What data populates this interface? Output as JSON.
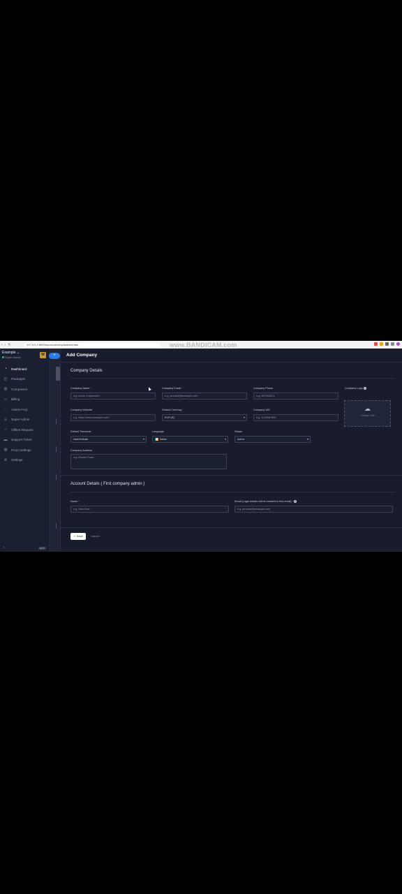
{
  "browser": {
    "url": "127.0.0.1:8000/account/companies/create",
    "watermark": "www.BANDICAM.com"
  },
  "sidebar": {
    "workspace_name": "Example",
    "role": "Super Admin",
    "logo_letter": "W",
    "items": [
      {
        "label": "Dashboard",
        "icon": "dashboard-icon",
        "glyph": "◔"
      },
      {
        "label": "Packages",
        "icon": "package-icon",
        "glyph": "◰"
      },
      {
        "label": "Companies",
        "icon": "building-icon",
        "glyph": "▥"
      },
      {
        "label": "Billing",
        "icon": "billing-icon",
        "glyph": "▭"
      },
      {
        "label": "Admin FAQ",
        "icon": "faq-icon",
        "glyph": "◌"
      },
      {
        "label": "Super Admin",
        "icon": "user-shield-icon",
        "glyph": "♙"
      },
      {
        "label": "Offline Request",
        "icon": "offline-icon",
        "glyph": "⌁"
      },
      {
        "label": "Support Ticket",
        "icon": "ticket-icon",
        "glyph": "▬"
      },
      {
        "label": "Front Settings",
        "icon": "front-settings-icon",
        "glyph": "▤"
      },
      {
        "label": "Settings",
        "icon": "gear-icon",
        "glyph": "⚙"
      }
    ],
    "collapse_glyph": "‹",
    "version": "v2.0"
  },
  "header": {
    "add_button_label": "+"
  },
  "modal": {
    "title": "Add Company",
    "company_section_title": "Company Details",
    "fields": {
      "company_name": {
        "label": "Company Name",
        "placeholder": "e.g. Acme Corporation"
      },
      "company_email": {
        "label": "Company Email",
        "placeholder": "e.g. johndoe@example.com"
      },
      "company_phone": {
        "label": "Company Phone",
        "placeholder": "e.g. 987654321"
      },
      "company_logo": {
        "label": "Company Logo",
        "upload_text": "Choose a file"
      },
      "company_website": {
        "label": "Company Website",
        "placeholder": "e.g. https://www.example.com/"
      },
      "default_currency": {
        "label": "Default Currency",
        "value": "EUR (€)"
      },
      "company_vat": {
        "label": "Company VAT",
        "placeholder": "e.g. 1234567891"
      },
      "default_timezone": {
        "label": "Default Timezone",
        "value": "Asia/Kolkata"
      },
      "language": {
        "label": "Language",
        "value": "Italian"
      },
      "status": {
        "label": "Status",
        "value": "Active"
      },
      "company_address": {
        "label": "Company Address",
        "placeholder": "e.g. Rocket Road"
      }
    },
    "account_section_title": "Account Details ( First company admin )",
    "account_fields": {
      "name": {
        "label": "Name",
        "placeholder": "e.g. John Doe"
      },
      "email": {
        "label": "Email (Login details will be emailed to this email)",
        "placeholder": "e.g. johndoe@example.com"
      }
    },
    "save_label": "Save",
    "cancel_label": "Cancel"
  }
}
